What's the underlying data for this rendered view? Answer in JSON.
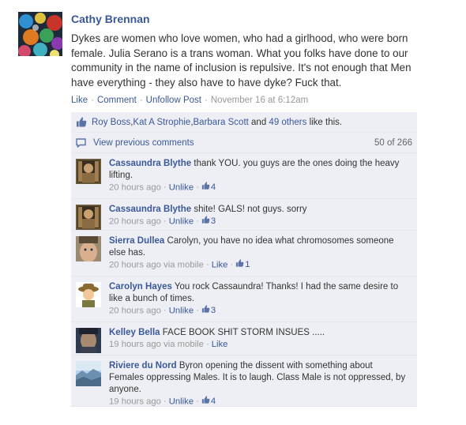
{
  "post": {
    "author": "Cathy Brennan",
    "text": "Dykes are women who love women, who had a girlhood, who were born female. Julia Serano is a trans woman. What you folks have done to our community in the name of inclusion is repulsive. It's not enough that Men have everything - they also have to have dyke? Fuck that.",
    "actions": {
      "like": "Like",
      "comment": "Comment",
      "unfollow": "Unfollow Post",
      "timestamp": "November 16 at 6:12am"
    }
  },
  "likes": {
    "people": [
      "Roy Boss",
      "Kat A Strophie",
      "Barbara Scott"
    ],
    "sep1": ", ",
    "sep2": ", ",
    "and": " and ",
    "others": "49 others",
    "suffix": " like this."
  },
  "view_previous": {
    "label": "View previous comments",
    "count": "50 of 266"
  },
  "comments": [
    {
      "author": "Cassaundra Blythe",
      "text": "thank YOU. you guys are the ones doing the heavy lifting.",
      "time": "20 hours ago",
      "via": "",
      "action": "Unlike",
      "likes": "4"
    },
    {
      "author": "Cassaundra Blythe",
      "text": "shite! GALS! not guys. sorry",
      "time": "20 hours ago",
      "via": "",
      "action": "Unlike",
      "likes": "3"
    },
    {
      "author": "Sierra Dullea",
      "text": "Carolyn, you have no idea what chromosomes someone else has.",
      "time": "20 hours ago",
      "via": "via mobile",
      "action": "Like",
      "likes": "1"
    },
    {
      "author": "Carolyn Hayes",
      "text": "You rock Cassaundra! Thanks! I had the same desire to like a bunch of times.",
      "time": "20 hours ago",
      "via": "",
      "action": "Unlike",
      "likes": "3"
    },
    {
      "author": "Kelley Bella",
      "text": "FACE BOOK SHIT STORM INSUES .....",
      "time": "19 hours ago",
      "via": "via mobile",
      "action": "Like",
      "likes": ""
    },
    {
      "author": "Riviere du Nord",
      "text": "Byron opening the dissent with something about Females oppressing Males. It is to laugh. Class Male is not oppressed, by anyone.",
      "time": "19 hours ago",
      "via": "",
      "action": "Unlike",
      "likes": "4"
    }
  ],
  "colors": {
    "link": "#3b5998",
    "ufi_bg": "#edeff4",
    "meta_grey": "#999999"
  },
  "icons": {
    "likes_row": "thumbs-up-icon",
    "view_row": "comment-bubble-icon",
    "comment_like": "thumbs-up-icon"
  }
}
